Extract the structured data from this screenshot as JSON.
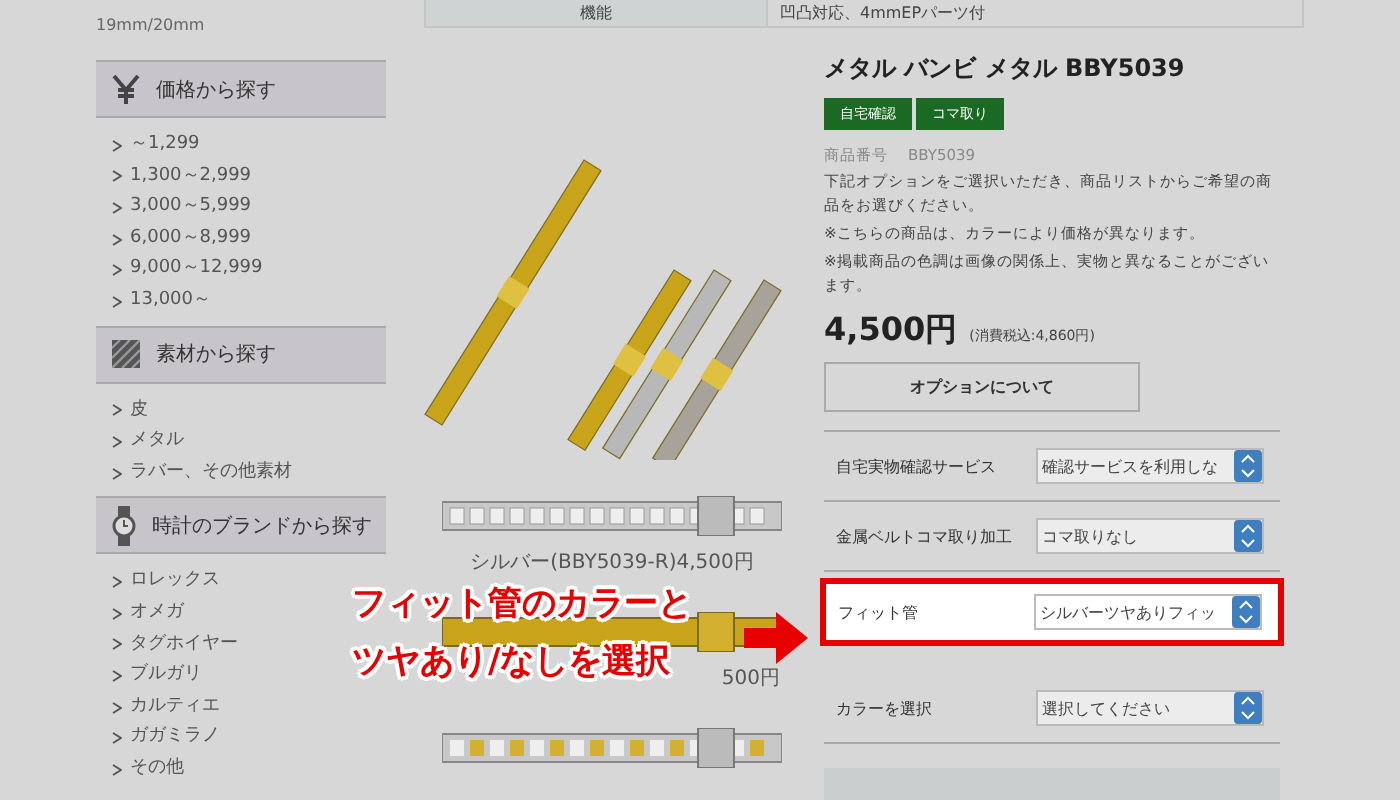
{
  "sidebar": {
    "size_text": "19mm/20mm",
    "sections": [
      {
        "kind": "yen",
        "title": "価格から探す",
        "items": [
          "～1,299",
          "1,300～2,999",
          "3,000～5,999",
          "6,000～8,999",
          "9,000～12,999",
          "13,000～"
        ]
      },
      {
        "kind": "material",
        "title": "素材から探す",
        "items": [
          "皮",
          "メタル",
          "ラバー、その他素材"
        ]
      },
      {
        "kind": "watch",
        "title": "時計のブランドから探す",
        "items": [
          "ロレックス",
          "オメガ",
          "タグホイヤー",
          "ブルガリ",
          "カルティエ",
          "ガガミラノ",
          "その他"
        ]
      }
    ]
  },
  "spec_row": {
    "label": "機能",
    "value": "凹凸対応、4mmEPパーツ付"
  },
  "gallery": {
    "captions": [
      "シルバー(BBY5039-R)4,500円",
      "500円"
    ]
  },
  "product": {
    "title": "メタル バンビ メタル BBY5039",
    "badges": [
      "自宅確認",
      "コマ取り"
    ],
    "number_label": "商品番号",
    "number": "BBY5039",
    "description": [
      "下記オプションをご選択いただき、商品リストからご希望の商品をお選びください。",
      "※こちらの商品は、カラーにより価格が異なります。",
      "※掲載商品の色調は画像の関係上、実物と異なることがございます。"
    ],
    "price": "4,500円",
    "tax_note": "(消費税込:4,860円)",
    "option_button": "オプションについて",
    "options": [
      {
        "label": "自宅実物確認サービス",
        "value": "確認サービスを利用しな",
        "highlighted": false
      },
      {
        "label": "金属ベルトコマ取り加工",
        "value": "コマ取りなし",
        "highlighted": false
      },
      {
        "label": "フィット管",
        "value": "シルバーツヤありフィッ",
        "highlighted": true
      },
      {
        "label": "カラーを選択",
        "value": "選択してください",
        "highlighted": false
      }
    ]
  },
  "callout": {
    "lines": [
      "フィット管のカラーと",
      "ツヤあり/なしを選択"
    ]
  }
}
